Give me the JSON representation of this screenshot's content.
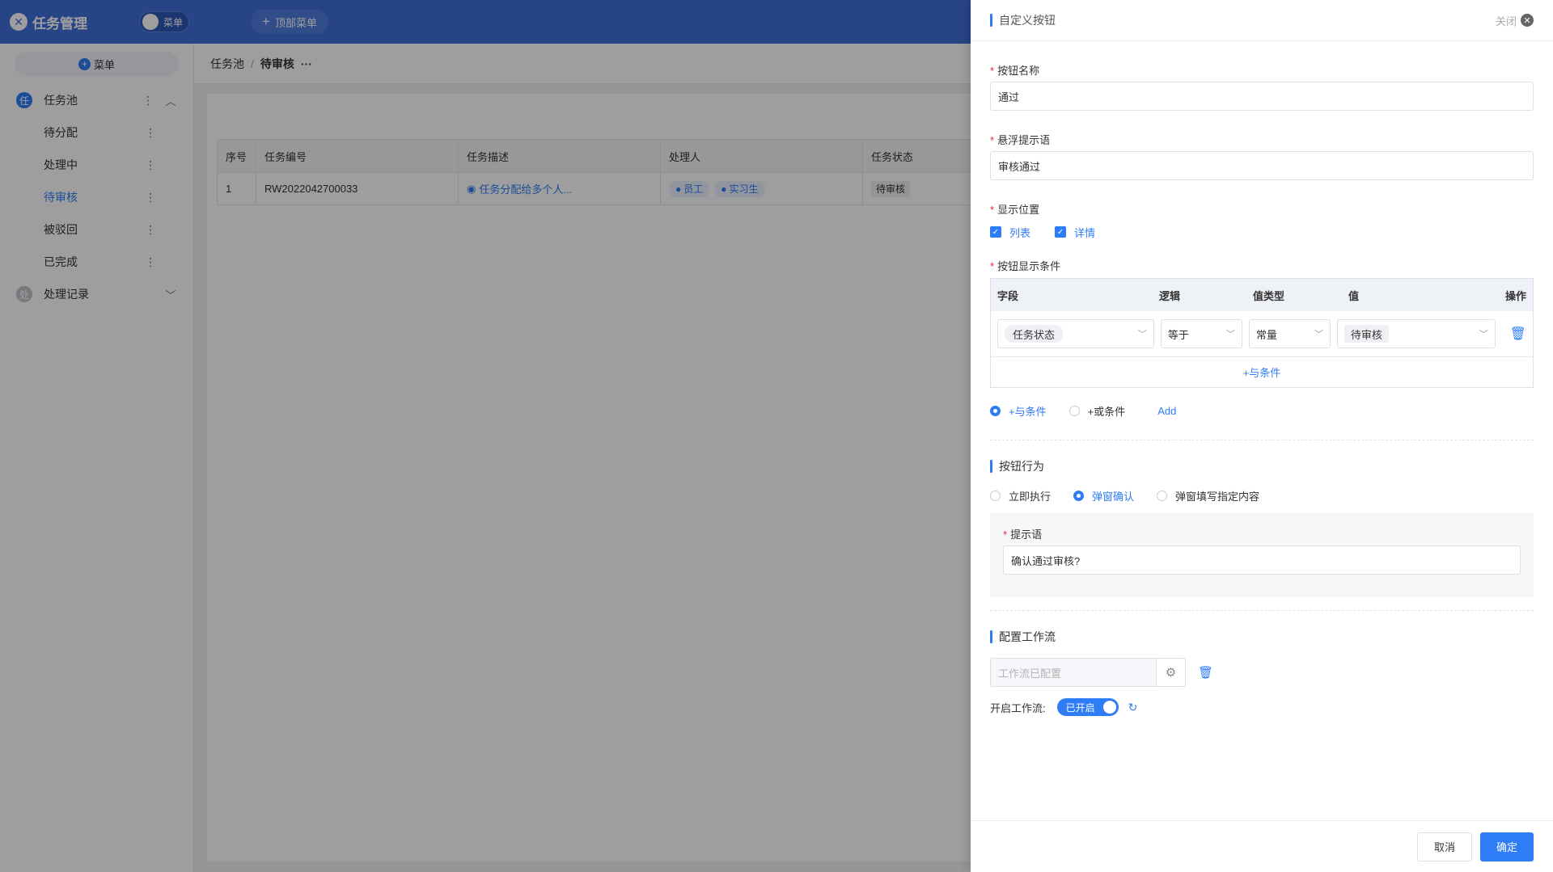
{
  "app": {
    "title": "任务管理",
    "menu_toggle": "菜单",
    "top_menu": "顶部菜单"
  },
  "sidebar": {
    "menu_button": "菜单",
    "groups": [
      {
        "icon_char": "任",
        "label": "任务池",
        "items": [
          {
            "label": "待分配"
          },
          {
            "label": "处理中"
          },
          {
            "label": "待审核"
          },
          {
            "label": "被驳回"
          },
          {
            "label": "已完成"
          }
        ]
      },
      {
        "icon_char": "处",
        "label": "处理记录"
      }
    ]
  },
  "breadcrumb": {
    "parent": "任务池",
    "separator": "/",
    "current": "待审核",
    "more": "···"
  },
  "table": {
    "headers": [
      "序号",
      "任务编号",
      "任务描述",
      "处理人",
      "任务状态"
    ],
    "rows": [
      {
        "index": "1",
        "code": "RW2022042700033",
        "desc": "任务分配给多个人...",
        "assignees": [
          "员工",
          "实习生"
        ],
        "status": "待审核"
      }
    ]
  },
  "drawer": {
    "title": "自定义按钮",
    "close_label": "关闭",
    "name_label": "按钮名称",
    "name_value": "通过",
    "tooltip_label": "悬浮提示语",
    "tooltip_value": "审核通过",
    "position_label": "显示位置",
    "position_options": [
      "列表",
      "详情"
    ],
    "condition_label": "按钮显示条件",
    "condition_headers": [
      "字段",
      "逻辑",
      "值类型",
      "值",
      "操作"
    ],
    "condition_row": {
      "field": "任务状态",
      "logic": "等于",
      "value_type": "常量",
      "value": "待审核"
    },
    "add_and": "+与条件",
    "radio_and": "+与条件",
    "radio_or": "+或条件",
    "add_link": "Add",
    "behavior_title": "按钮行为",
    "behavior_options": [
      "立即执行",
      "弹窗确认",
      "弹窗填写指定内容"
    ],
    "prompt_label": "提示语",
    "prompt_value": "确认通过审核?",
    "workflow_title": "配置工作流",
    "workflow_placeholder": "工作流已配置",
    "enable_workflow_label": "开启工作流:",
    "switch_label": "已开启",
    "cancel": "取消",
    "confirm": "确定"
  }
}
